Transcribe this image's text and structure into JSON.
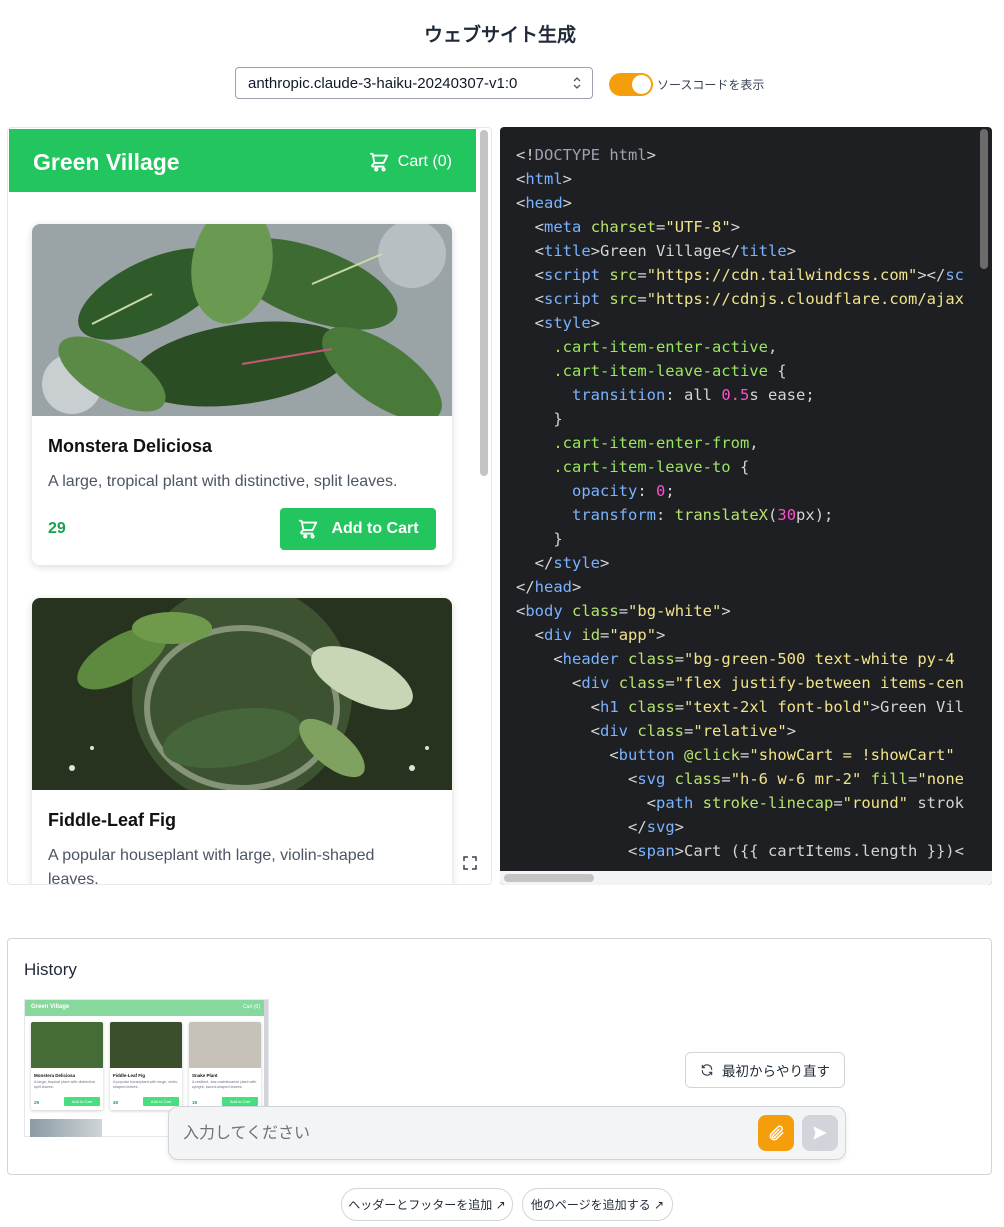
{
  "page": {
    "title": "ウェブサイト生成",
    "model": "anthropic.claude-3-haiku-20240307-v1:0",
    "toggle_label": "ソースコードを表示",
    "toggle_on": true,
    "accent_color": "#f59e0b"
  },
  "preview": {
    "brand": "Green Village",
    "cart_label": "Cart (0)",
    "brand_color": "#22c55e",
    "products": [
      {
        "name": "Monstera Deliciosa",
        "desc": "A large, tropical plant with distinctive, split leaves.",
        "price": "29",
        "button": "Add to Cart"
      },
      {
        "name": "Fiddle-Leaf Fig",
        "desc": "A popular houseplant with large, violin-shaped leaves."
      }
    ]
  },
  "code_lines": [
    "<!DOCTYPE html>",
    "<html>",
    "<head>",
    "  <meta charset=\"UTF-8\">",
    "  <title>Green Village</title>",
    "  <script src=\"https://cdn.tailwindcss.com\"></sc",
    "  <script src=\"https://cdnjs.cloudflare.com/ajax",
    "  <style>",
    "    .cart-item-enter-active,",
    "    .cart-item-leave-active {",
    "      transition: all 0.5s ease;",
    "    }",
    "    .cart-item-enter-from,",
    "    .cart-item-leave-to {",
    "      opacity: 0;",
    "      transform: translateX(30px);",
    "    }",
    "  </style>",
    "</head>",
    "<body class=\"bg-white\">",
    "  <div id=\"app\">",
    "    <header class=\"bg-green-500 text-white py-4",
    "      <div class=\"flex justify-between items-cen",
    "        <h1 class=\"text-2xl font-bold\">Green Vil",
    "        <div class=\"relative\">",
    "          <button @click=\"showCart = !showCart\"",
    "            <svg class=\"h-6 w-6 mr-2\" fill=\"none",
    "              <path stroke-linecap=\"round\" strok",
    "            </svg>",
    "            <span>Cart ({{ cartItems.length }})<"
  ],
  "history": {
    "title": "History",
    "thumb": {
      "brand": "Green Village",
      "cart": "Cart (0)",
      "cards": [
        {
          "name": "Monstera Deliciosa",
          "desc": "A large, tropical plant with distinctive, split leaves.",
          "price": "29",
          "button": "Add to Cart"
        },
        {
          "name": "Fiddle-Leaf Fig",
          "desc": "A popular houseplant with large, violin-shaped leaves.",
          "price": "49",
          "button": "Add to Cart"
        },
        {
          "name": "Snake Plant",
          "desc": "A resilient, low-maintenance plant with upright, sword-shaped leaves.",
          "price": "19",
          "button": "Add to Cart"
        }
      ]
    }
  },
  "restart_label": "最初からやり直す",
  "chat": {
    "placeholder": "入力してください"
  },
  "suggestions": [
    "ヘッダーとフッターを追加 ↗",
    "他のページを追加する ↗"
  ]
}
